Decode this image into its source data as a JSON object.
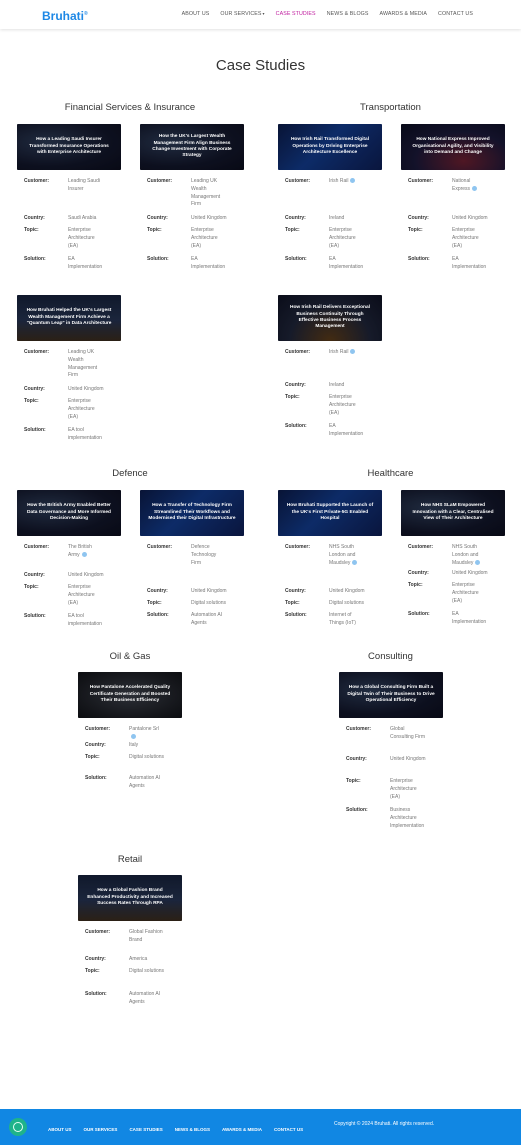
{
  "header": {
    "logo": "Bruhati",
    "logo_mark": "®",
    "nav": [
      {
        "label": "ABOUT US"
      },
      {
        "label": "OUR SERVICES"
      },
      {
        "label": "CASE STUDIES"
      },
      {
        "label": "NEWS & BLOGS"
      },
      {
        "label": "AWARDS & MEDIA"
      },
      {
        "label": "CONTACT US"
      }
    ]
  },
  "page_title": "Case Studies",
  "labels": {
    "customer": "Customer:",
    "country": "Country:",
    "topic": "Topic:",
    "solution": "Solution:"
  },
  "sections": {
    "financial": "Financial Services & Insurance",
    "transportation": "Transportation",
    "defence": "Defence",
    "healthcare": "Healthcare",
    "oilgas": "Oil & Gas",
    "consulting": "Consulting",
    "retail": "Retail"
  },
  "cards": [
    {
      "title": "How a Leading Saudi Insurer Transformed Insurance Operations with Enterprise Architecture",
      "customer": "Leading Saudi Insurer",
      "country": "Saudi Arabia",
      "topic": "Enterprise Architecture (EA)",
      "solution": "EA Implementation"
    },
    {
      "title": "How the UK's Largest Wealth Management Firm Align Business Change Investment with Corporate Strategy",
      "customer": "Leading UK Wealth Management Firm",
      "country": "United Kingdom",
      "topic": "Enterprise Architecture (EA)",
      "solution": "EA Implementation"
    },
    {
      "title": "How Irish Rail Transformed Digital Operations by Driving Enterprise Architecture Excellence",
      "customer": "Irish Rail",
      "country": "Ireland",
      "topic": "Enterprise Architecture (EA)",
      "solution": "EA Implementation"
    },
    {
      "title": "How National Express Improved Organisational Agility, and Visibility into Demand and Change",
      "customer": "National Express",
      "country": "United Kingdom",
      "topic": "Enterprise Architecture (EA)",
      "solution": "EA Implementation"
    },
    {
      "title": "How Bruhati Helped the UK's Largest Wealth Management Firm Achieve a \"Quantum Leap\" in Data Architecture",
      "customer": "Leading UK Wealth Management Firm",
      "country": "United Kingdom",
      "topic": "Enterprise Architecture (EA)",
      "solution": "EA tool implementation"
    },
    {
      "title": "How Irish Rail Delivers Exceptional Business Continuity Through Effective Business Process Management",
      "customer": "Irish Rail",
      "country": "Ireland",
      "topic": "Enterprise Architecture (EA)",
      "solution": "EA Implementation"
    },
    {
      "title": "How the British Army Enabled Better Data Governance and More Informed Decision-Making",
      "customer": "The British Army",
      "country": "United Kingdom",
      "topic": "Enterprise Architecture (EA)",
      "solution": "EA tool implementation"
    },
    {
      "title": "How a Transfer of Technology Firm Streamlined Their Workflows and Modernised their Digital Infrastructure",
      "customer": "Defence Technology Firm",
      "country": "United Kingdom",
      "topic": "Digital solutions",
      "solution": "Automation AI Agents"
    },
    {
      "title": "How Bruhati Supported the Launch of the UK's First Private-5G Enabled Hospital",
      "customer": "NHS South London and Maudsley",
      "country": "United Kingdom",
      "topic": "Digital solutions",
      "solution": "Internet of Things (IoT)"
    },
    {
      "title": "How NHS SLaM Empowered Innovation with a Clear, Centralised View of Their Architecture",
      "customer": "NHS South London and Maudsley",
      "country": "United Kingdom",
      "topic": "Enterprise Architecture (EA)",
      "solution": "EA Implementation"
    },
    {
      "title": "How Pantalone Accelerated Quality Certificate Generation and Boosted Their Business Efficiency",
      "customer": "Pantalone Srl",
      "country": "Italy",
      "topic": "Digital solutions",
      "solution": "Automation AI Agents"
    },
    {
      "title": "How a Global Consulting Firm Built a Digital Twin of Their Business to Drive Operational Efficiency",
      "customer": "Global Consulting Firm",
      "country": "United Kingdom",
      "topic": "Enterprise Architecture (EA)",
      "solution": "Business Architecture Implementation"
    },
    {
      "title": "How a Global Fashion Brand Enhanced Productivity and Increased Success Rates Through RPA",
      "customer": "Global Fashion Brand",
      "country": "America",
      "topic": "Digital solutions",
      "solution": "Automation AI Agents"
    }
  ],
  "footer": {
    "nav": [
      {
        "label": "ABOUT US"
      },
      {
        "label": "OUR SERVICES"
      },
      {
        "label": "CASE STUDIES"
      },
      {
        "label": "NEWS & BLOGS"
      },
      {
        "label": "AWARDS & MEDIA"
      },
      {
        "label": "CONTACT US"
      }
    ],
    "copyright": "Copyright © 2024 Bruhati. All rights reserved."
  },
  "colors": {
    "brand": "#1e88e5",
    "active_nav": "#c020a0",
    "footer": "#1187e3",
    "twitter": "#8fc5f0"
  }
}
